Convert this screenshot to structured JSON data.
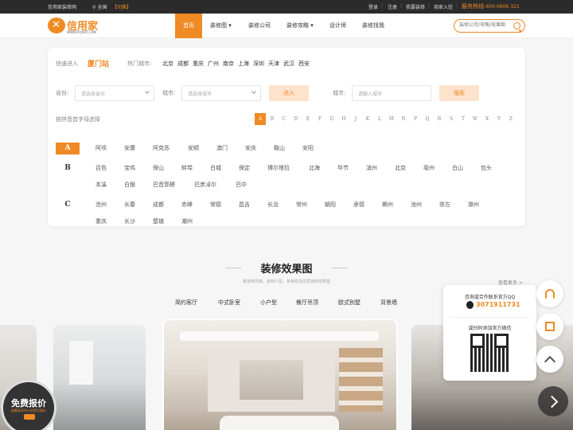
{
  "topbar": {
    "site_name": "信用家装修网",
    "location": "全国",
    "switch": "【切换】",
    "links": [
      "登录",
      "注册",
      "我要装修",
      "商家入驻"
    ],
    "hotline_label": "服务热线:",
    "hotline": "400-0606-321"
  },
  "header": {
    "logo_text": "信用家",
    "logo_sub": "WWW.XYJAXT.COM",
    "nav": [
      "首页",
      "装修图",
      "装修公司",
      "装修攻略",
      "设计师",
      "装修找我"
    ],
    "search_placeholder": "装修公司/攻略/效果图"
  },
  "city_panel": {
    "quick_label": "快速进入",
    "station": "厦门站",
    "hot_label": "热门城市:",
    "hot_cities": [
      "北京",
      "成都",
      "重庆",
      "广州",
      "南京",
      "上海",
      "深圳",
      "天津",
      "武汉",
      "西安"
    ],
    "province_label": "省份:",
    "province_placeholder": "请选择省份",
    "city_label": "城市:",
    "city_placeholder": "请选择城市",
    "enter_button": "进入",
    "city_search_label": "城市:",
    "city_search_placeholder": "请输入城市",
    "search_button": "搜索",
    "pinyin_label": "按拼音首字母选择",
    "letters": [
      "A",
      "B",
      "C",
      "D",
      "E",
      "F",
      "G",
      "H",
      "J",
      "K",
      "L",
      "M",
      "N",
      "P",
      "Q",
      "R",
      "S",
      "T",
      "W",
      "X",
      "Y",
      "Z"
    ],
    "active_letter": "A",
    "groups": [
      {
        "letter": "A",
        "cities": [
          "阿坝",
          "安康",
          "阿克苏",
          "安顺",
          "澳门",
          "安庆",
          "鞍山",
          "安阳"
        ]
      },
      {
        "letter": "B",
        "cities": [
          "百色",
          "宝鸡",
          "保山",
          "蚌埠",
          "白城",
          "保定",
          "博尔塔拉",
          "北海",
          "毕节",
          "滨州",
          "北京",
          "亳州",
          "白山",
          "包头",
          "本溪",
          "白银",
          "巴音郭楞",
          "巴彦淖尔",
          "巴中"
        ]
      },
      {
        "letter": "C",
        "cities": [
          "沧州",
          "长春",
          "成都",
          "赤峰",
          "常德",
          "昌吉",
          "长治",
          "常州",
          "朝阳",
          "承德",
          "郴州",
          "池州",
          "崇左",
          "滁州",
          "重庆",
          "长沙",
          "楚雄",
          "潮州"
        ]
      }
    ]
  },
  "gallery": {
    "title": "装修效果图",
    "subtitle": "聚各种风格、各种户型、各种高清优质装修效果图",
    "more": "查看更多 >",
    "tabs": [
      "简约客厅",
      "中式卧室",
      "小户型",
      "餐厅吊顶",
      "欧式别墅",
      "背景墙"
    ]
  },
  "quote_badge": {
    "title": "免费报价",
    "subtitle": "结算省30%+的官方报价"
  },
  "contact": {
    "qq_label": "咨询或合作联系官方QQ",
    "qq_number": "3071911731",
    "wechat_label": "或扫码添加官方微信"
  },
  "colors": {
    "accent": "#f08a24",
    "topbar": "#2b2b2b"
  }
}
